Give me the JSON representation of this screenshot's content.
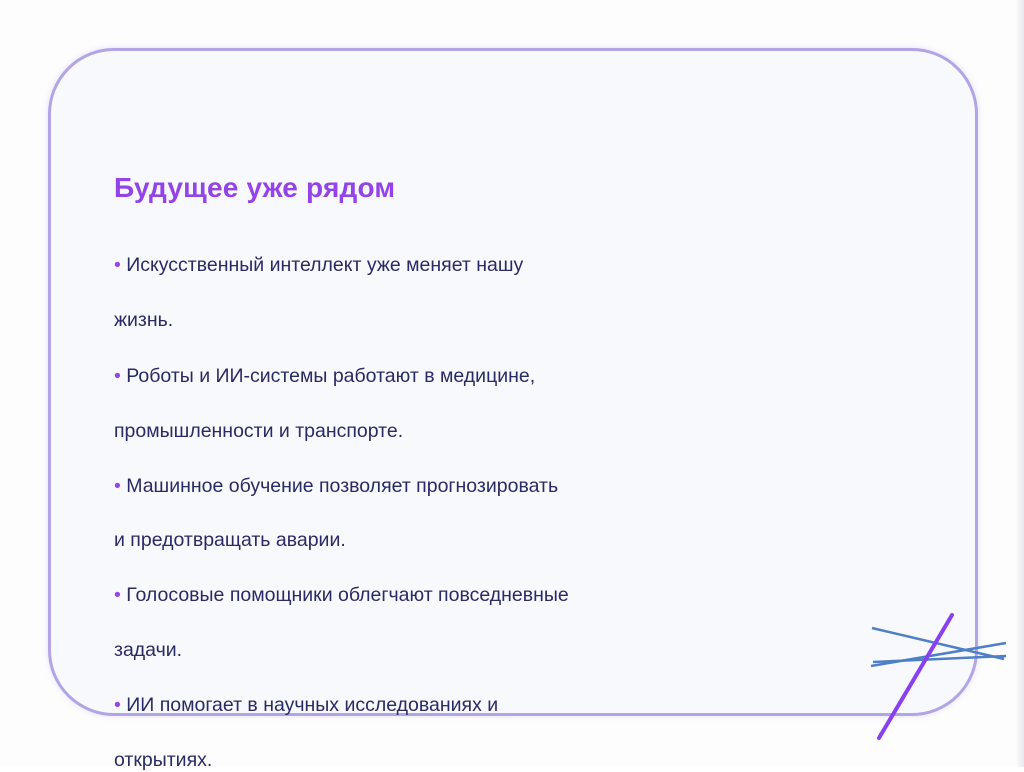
{
  "slide": {
    "title": "Будущее уже рядом",
    "bullet_char": "•",
    "lines": [
      {
        "bullet": true,
        "text": "Искусственный интеллект уже меняет нашу"
      },
      {
        "bullet": false,
        "text": "жизнь."
      },
      {
        "bullet": true,
        "text": "Роботы и ИИ-системы работают в медицине,"
      },
      {
        "bullet": false,
        "text": "промышленности и транспорте."
      },
      {
        "bullet": true,
        "text": "Машинное обучение позволяет прогнозировать"
      },
      {
        "bullet": false,
        "text": "и предотвращать аварии."
      },
      {
        "bullet": true,
        "text": "Голосовые помощники облегчают повседневные"
      },
      {
        "bullet": false,
        "text": "задачи."
      },
      {
        "bullet": true,
        "text": "ИИ помогает в научных исследованиях и"
      },
      {
        "bullet": false,
        "text": "открытиях."
      }
    ]
  },
  "colors": {
    "title": "#9343e8",
    "text": "#2a2a64",
    "frame": "#b3a4e6",
    "deco_purple": "#8a3ff0",
    "deco_blue": "#4f7fc4"
  },
  "decoration": "crossed-lines-icon"
}
